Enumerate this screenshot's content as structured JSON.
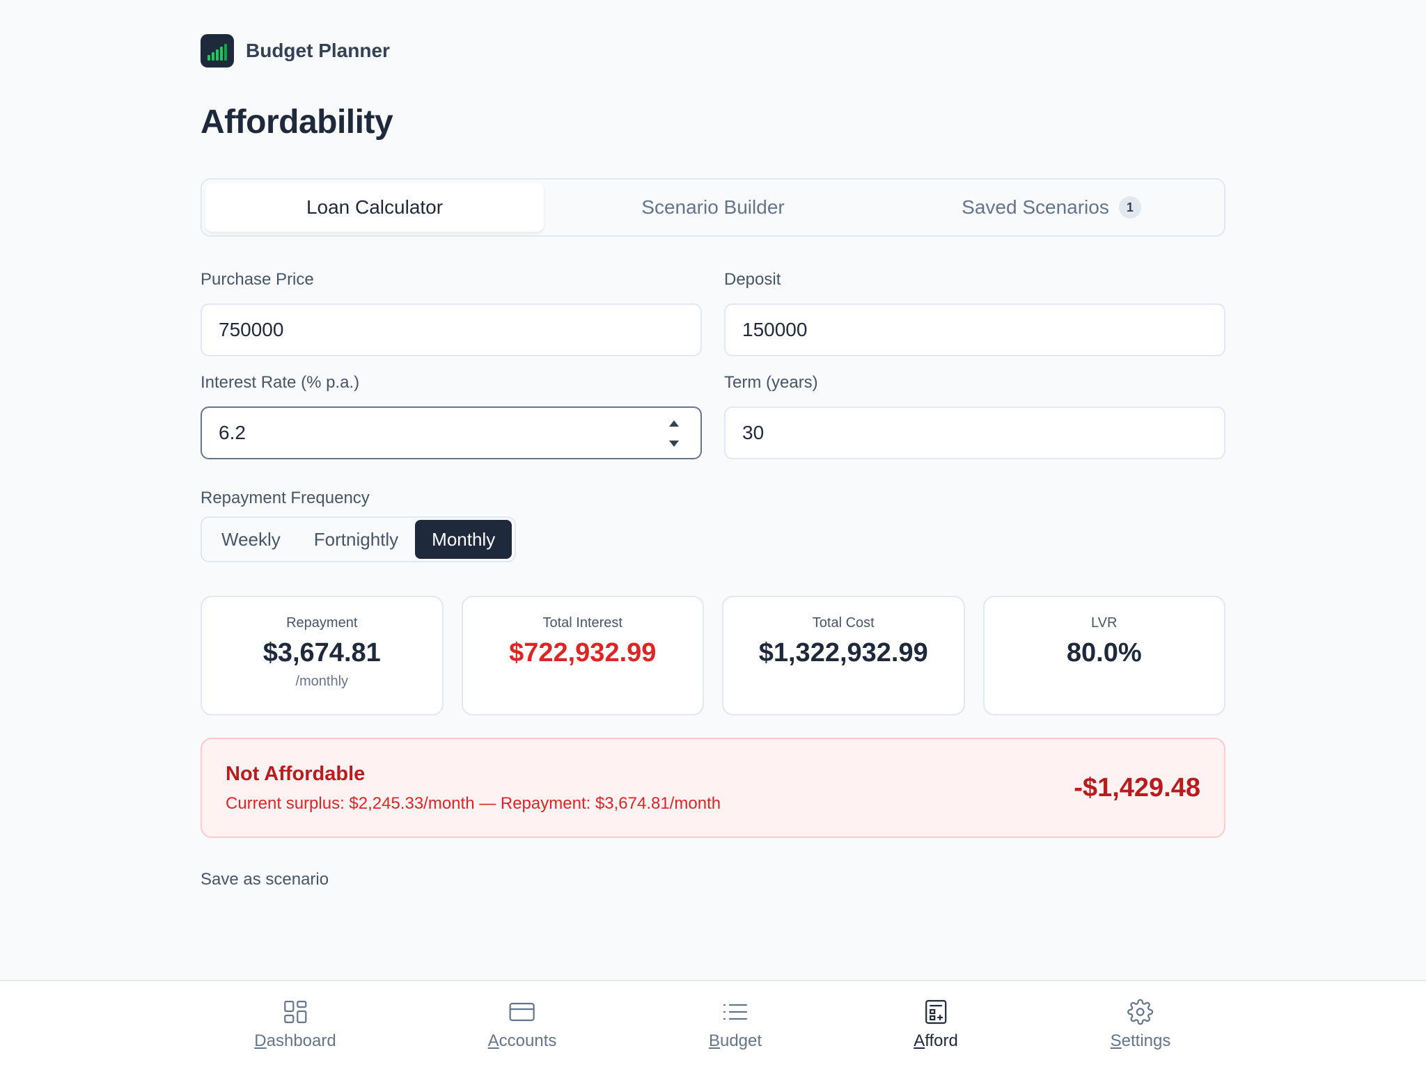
{
  "app": {
    "name": "Budget Planner"
  },
  "page": {
    "title": "Affordability"
  },
  "tabs": [
    {
      "label": "Loan Calculator",
      "active": true
    },
    {
      "label": "Scenario Builder",
      "active": false
    },
    {
      "label": "Saved Scenarios",
      "badge": "1",
      "active": false
    }
  ],
  "form": {
    "purchase_price": {
      "label": "Purchase Price",
      "value": "750000"
    },
    "deposit": {
      "label": "Deposit",
      "value": "150000"
    },
    "interest_rate": {
      "label": "Interest Rate (% p.a.)",
      "value": "6.2"
    },
    "term": {
      "label": "Term (years)",
      "value": "30"
    }
  },
  "frequency": {
    "label": "Repayment Frequency",
    "options": [
      "Weekly",
      "Fortnightly",
      "Monthly"
    ],
    "selected": "Monthly"
  },
  "stats": [
    {
      "label": "Repayment",
      "value": "$3,674.81",
      "sub": "/monthly"
    },
    {
      "label": "Total Interest",
      "value": "$722,932.99"
    },
    {
      "label": "Total Cost",
      "value": "$1,322,932.99"
    },
    {
      "label": "LVR",
      "value": "80.0%"
    }
  ],
  "alert": {
    "title": "Not Affordable",
    "description": "Current surplus: $2,245.33/month — Repayment: $3,674.81/month",
    "amount": "-$1,429.48"
  },
  "actions": {
    "save_label": "Save as scenario"
  },
  "nav": [
    {
      "label": "Dashboard",
      "icon": "dashboard-icon"
    },
    {
      "label": "Accounts",
      "icon": "card-icon"
    },
    {
      "label": "Budget",
      "icon": "list-icon"
    },
    {
      "label": "Afford",
      "icon": "calculator-icon",
      "active": true
    },
    {
      "label": "Settings",
      "icon": "gear-icon"
    }
  ],
  "colors": {
    "primary": "#1e293b",
    "danger": "#dc2626",
    "danger_bg": "#fef2f2",
    "logo_bars": "#22c55e"
  }
}
